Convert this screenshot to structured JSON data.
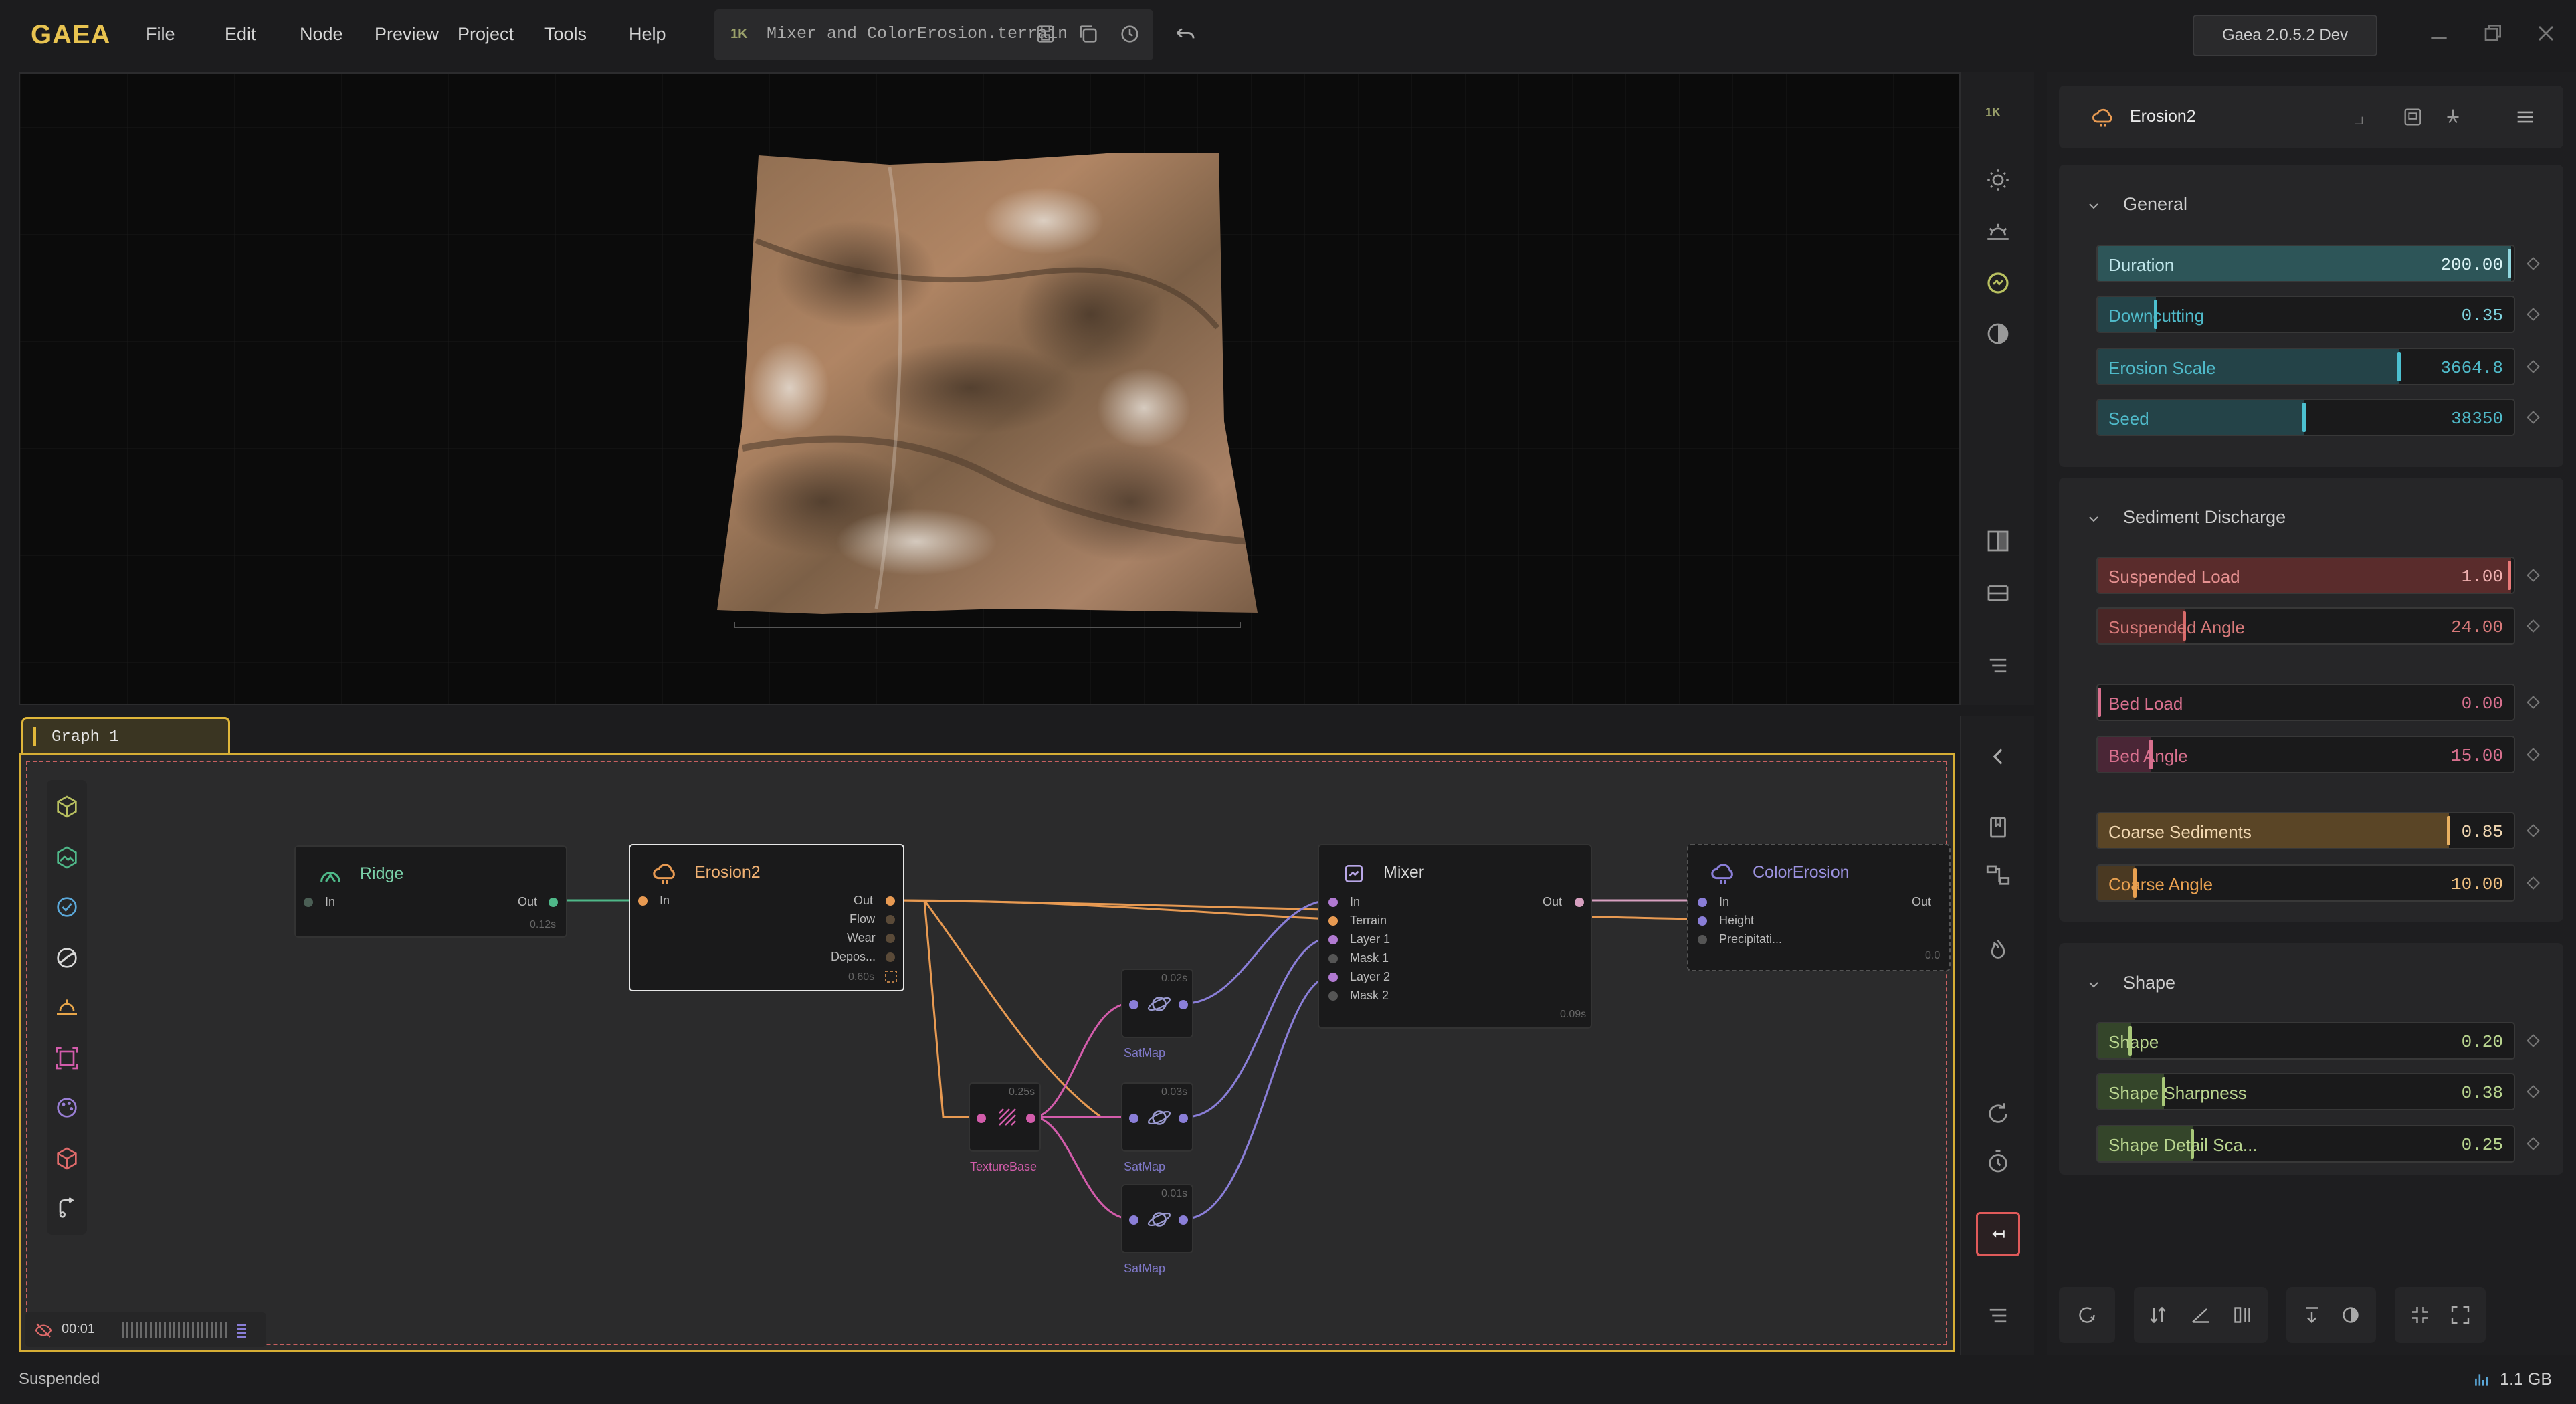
{
  "app": {
    "logo": "GAEA",
    "menu": [
      "File",
      "Edit",
      "Node",
      "Preview",
      "Project",
      "Tools",
      "Help"
    ],
    "resolution_badge": "1K",
    "file_name": "Mixer and ColorErosion.terrain",
    "version": "Gaea 2.0.5.2 Dev"
  },
  "viewport": {
    "resolution_badge": "1K"
  },
  "graph": {
    "tab_label": "Graph 1",
    "timer": "00:01",
    "nodes": {
      "ridge": {
        "title": "Ridge",
        "in": "In",
        "out": "Out",
        "time": "0.12s"
      },
      "erosion": {
        "title": "Erosion2",
        "in": "In",
        "outs": [
          "Out",
          "Flow",
          "Wear",
          "Depos..."
        ],
        "time": "0.60s"
      },
      "mixer": {
        "title": "Mixer",
        "ins": [
          "In",
          "Terrain",
          "Layer 1",
          "Mask 1",
          "Layer 2",
          "Mask 2"
        ],
        "out": "Out",
        "time": "0.09s"
      },
      "color_erosion": {
        "title": "ColorErosion",
        "ins": [
          "In",
          "Height",
          "Precipitati..."
        ],
        "out": "Out",
        "time": "0.0"
      },
      "texture_base": {
        "title": "TextureBase",
        "time": "0.25s"
      },
      "satmap1": {
        "title": "SatMap",
        "time": "0.02s"
      },
      "satmap2": {
        "title": "SatMap",
        "time": "0.03s"
      },
      "satmap3": {
        "title": "SatMap",
        "time": "0.01s"
      }
    },
    "colors": {
      "ridge": "#4fb889",
      "erosion": "#e89a52",
      "mixer": "#9a7fd6",
      "color_erosion": "#8a7ed8",
      "texture": "#d35cab",
      "satmap": "#8a7ed8"
    }
  },
  "properties": {
    "node_title": "Erosion2",
    "sections": {
      "general": {
        "title": "General",
        "params": [
          {
            "label": "Duration",
            "value": "200.00",
            "level": 1.0
          },
          {
            "label": "Downcutting",
            "value": "0.35",
            "level": 0.14
          },
          {
            "label": "Erosion Scale",
            "value": "3664.8",
            "level": 0.73
          },
          {
            "label": "Seed",
            "value": "38350",
            "level": 0.5
          }
        ]
      },
      "sediment": {
        "title": "Sediment Discharge",
        "params": [
          {
            "label": "Suspended Load",
            "value": "1.00",
            "level": 1.0
          },
          {
            "label": "Suspended Angle",
            "value": "24.00",
            "level": 0.21
          },
          {
            "label": "Bed Load",
            "value": "0.00",
            "level": 0.0
          },
          {
            "label": "Bed Angle",
            "value": "15.00",
            "level": 0.13
          },
          {
            "label": "Coarse Sediments",
            "value": "0.85",
            "level": 0.85
          },
          {
            "label": "Coarse Angle",
            "value": "10.00",
            "level": 0.09
          }
        ]
      },
      "shape": {
        "title": "Shape",
        "params": [
          {
            "label": "Shape",
            "value": "0.20",
            "level": 0.08
          },
          {
            "label": "Shape Sharpness",
            "value": "0.38",
            "level": 0.16
          },
          {
            "label": "Shape Detail Sca...",
            "value": "0.25",
            "level": 0.23
          }
        ]
      }
    }
  },
  "status": {
    "text": "Suspended",
    "memory": "1.1 GB"
  }
}
